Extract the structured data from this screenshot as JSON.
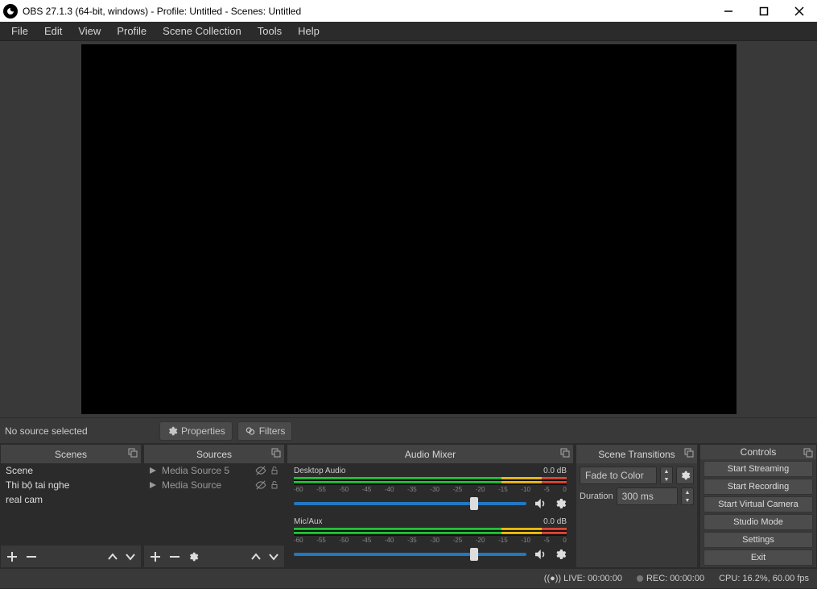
{
  "titlebar": {
    "title": "OBS 27.1.3 (64-bit, windows) - Profile: Untitled - Scenes: Untitled"
  },
  "menu": {
    "file": "File",
    "edit": "Edit",
    "view": "View",
    "profile": "Profile",
    "scene_collection": "Scene Collection",
    "tools": "Tools",
    "help": "Help"
  },
  "src_toolbar": {
    "status": "No source selected",
    "properties": "Properties",
    "filters": "Filters"
  },
  "scenes": {
    "title": "Scenes",
    "items": [
      "Scene",
      "Thi bộ tai nghe",
      "real cam"
    ]
  },
  "sources": {
    "title": "Sources",
    "items": [
      "Media Source 5",
      "Media Source"
    ]
  },
  "mixer": {
    "title": "Audio Mixer",
    "channels": [
      {
        "name": "Desktop Audio",
        "db": "0.0 dB",
        "ticks": [
          "-60",
          "-55",
          "-50",
          "-45",
          "-40",
          "-35",
          "-30",
          "-25",
          "-20",
          "-15",
          "-10",
          "-5",
          "0"
        ]
      },
      {
        "name": "Mic/Aux",
        "db": "0.0 dB",
        "ticks": [
          "-60",
          "-55",
          "-50",
          "-45",
          "-40",
          "-35",
          "-30",
          "-25",
          "-20",
          "-15",
          "-10",
          "-5",
          "0"
        ]
      }
    ]
  },
  "transitions": {
    "title": "Scene Transitions",
    "mode": "Fade to Color",
    "duration_label": "Duration",
    "duration_value": "300 ms"
  },
  "controls": {
    "title": "Controls",
    "buttons": {
      "stream": "Start Streaming",
      "record": "Start Recording",
      "vcam": "Start Virtual Camera",
      "studio": "Studio Mode",
      "settings": "Settings",
      "exit": "Exit"
    }
  },
  "status": {
    "live": "LIVE: 00:00:00",
    "rec": "REC: 00:00:00",
    "cpu": "CPU: 16.2%, 60.00 fps"
  }
}
